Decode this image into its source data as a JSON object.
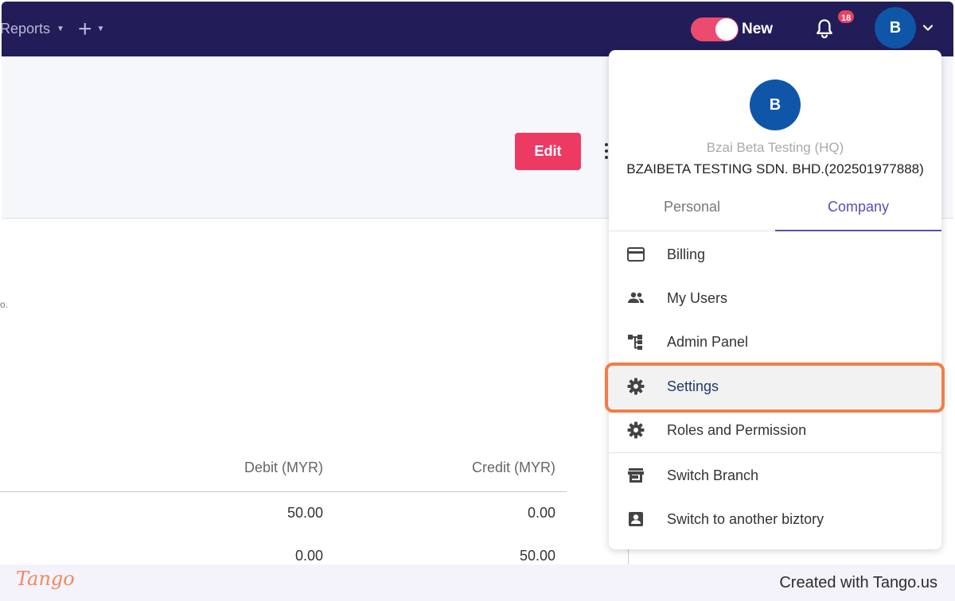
{
  "nav": {
    "reports_label": "Reports",
    "new_toggle_label": "New",
    "notification_count": "18",
    "avatar_initial": "B",
    "colors": {
      "bar": "#211d59",
      "toggle": "#ec4a6e",
      "avatar": "#0f56a8"
    }
  },
  "page": {
    "edit_label": "Edit",
    "stray_text": "o.",
    "table": {
      "headers": {
        "debit": "Debit (MYR)",
        "credit": "Credit (MYR)"
      },
      "rows": [
        {
          "debit": "50.00",
          "credit": "0.00"
        },
        {
          "debit": "0.00",
          "credit": "50.00"
        }
      ]
    }
  },
  "dropdown": {
    "avatar_initial": "B",
    "branch_name": "Bzai Beta Testing (HQ)",
    "company_name": "BZAIBETA TESTING SDN. BHD.(202501977888)",
    "tabs": [
      {
        "label": "Personal",
        "active": false
      },
      {
        "label": "Company",
        "active": true
      }
    ],
    "items": [
      {
        "label": "Billing",
        "icon": "credit-card-icon"
      },
      {
        "label": "My Users",
        "icon": "people-icon"
      },
      {
        "label": "Admin Panel",
        "icon": "hierarchy-icon"
      },
      {
        "label": "Settings",
        "icon": "gear-icon",
        "active": true
      },
      {
        "label": "Roles and Permission",
        "icon": "gear-icon"
      },
      {
        "label": "Switch Branch",
        "icon": "store-icon"
      },
      {
        "label": "Switch to another biztory",
        "icon": "account-box-icon"
      }
    ]
  },
  "footer": {
    "logo": "Tango",
    "credit": "Created with Tango.us"
  }
}
